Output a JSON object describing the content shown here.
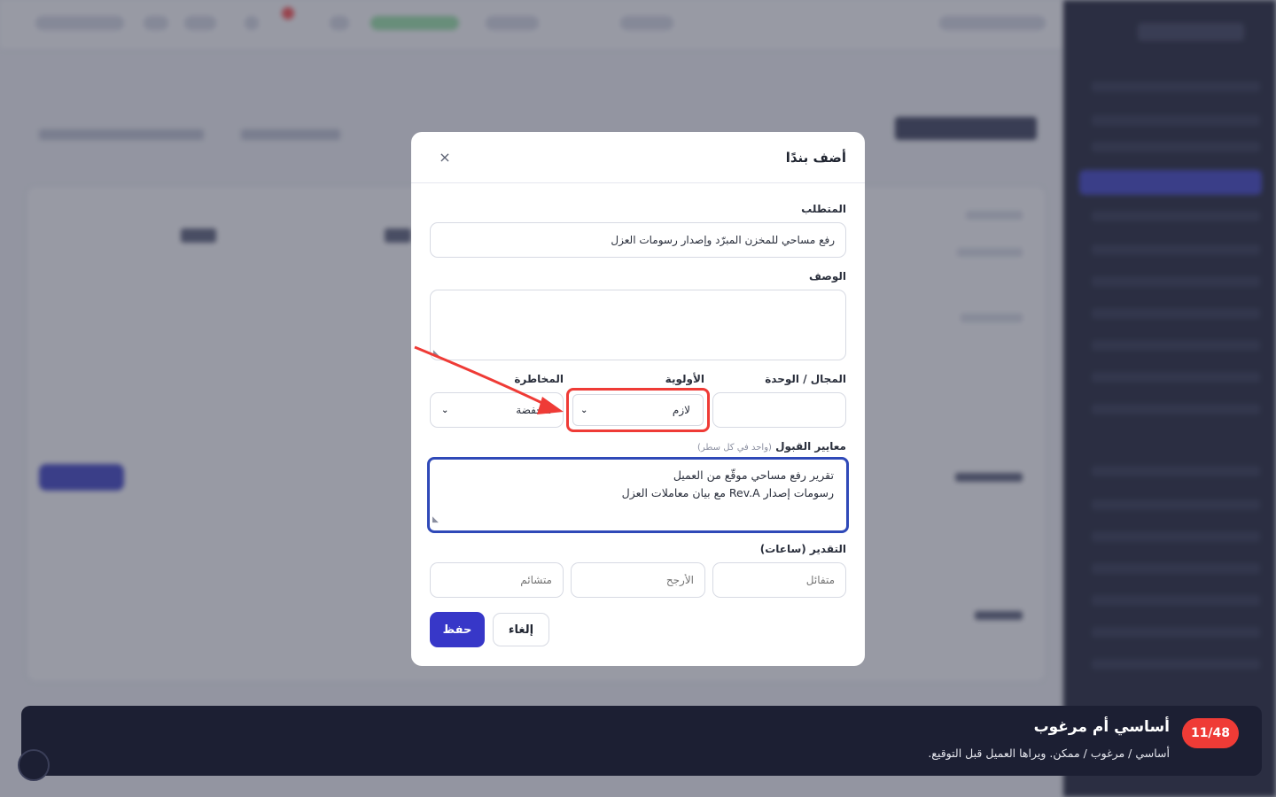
{
  "modal": {
    "title": "أضف بندًا",
    "close_icon": "×",
    "requirement": {
      "label": "المتطلب",
      "value": "رفع مساحي للمخزن المبرّد وإصدار رسومات العزل"
    },
    "description": {
      "label": "الوصف",
      "value": ""
    },
    "domain_unit": {
      "label": "المجال / الوحدة",
      "value": ""
    },
    "priority": {
      "label": "الأولوية",
      "value": "لازم"
    },
    "risk": {
      "label": "المخاطرة",
      "value": "منخفضة"
    },
    "acceptance": {
      "label": "معايير القبول",
      "hint": "(واحد في كل سطر)",
      "line1": "تقرير رفع مساحي موقّع من العميل",
      "line2": "رسومات إصدار Rev.A مع بيان معاملات العزل"
    },
    "estimate": {
      "label": "التقدير (ساعات)",
      "optimistic_placeholder": "متفائل",
      "likely_placeholder": "الأرجح",
      "pessimistic_placeholder": "متشائم"
    },
    "save_label": "حفظ",
    "cancel_label": "إلغاء"
  },
  "tour": {
    "step": "11/48",
    "title": "أساسي أم مرغوب",
    "description": "أساسي / مرغوب / ممكن. ويراها العميل قبل التوقيع."
  },
  "colors": {
    "primary": "#3737c8",
    "highlight": "#ef3b36",
    "focus_ring": "#2f49b8",
    "tour_bg": "#1c1f33"
  },
  "icons": {
    "close": "close-icon",
    "chevron": "chevron-down-icon",
    "arrow": "pointer-arrow"
  }
}
